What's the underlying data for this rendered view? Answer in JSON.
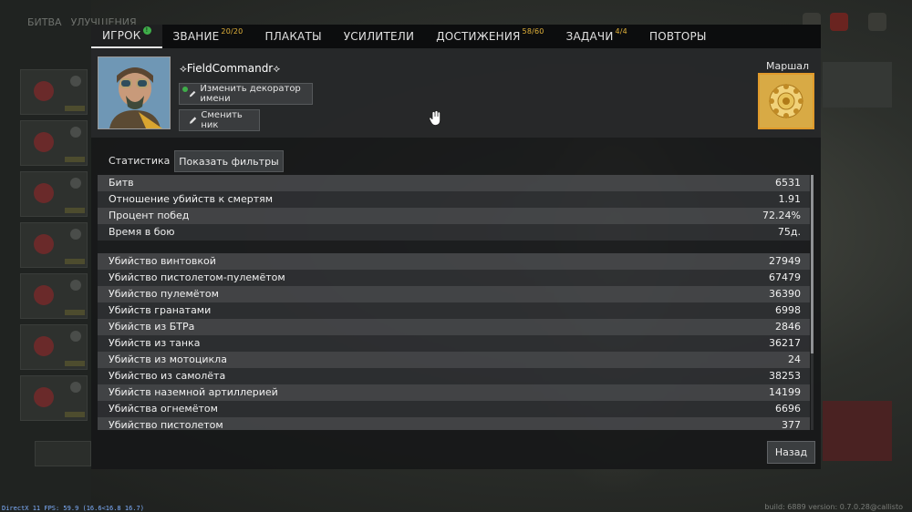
{
  "tabs": [
    {
      "label": "ИГРОК",
      "badge": "!"
    },
    {
      "label": "ЗВАНИЕ",
      "count": "20/20"
    },
    {
      "label": "ПЛАКАТЫ"
    },
    {
      "label": "УСИЛИТЕЛИ"
    },
    {
      "label": "ДОСТИЖЕНИЯ",
      "count": "58/60"
    },
    {
      "label": "ЗАДАЧИ",
      "count": "4/4"
    },
    {
      "label": "ПОВТОРЫ"
    }
  ],
  "background": {
    "tab_battle": "БИТВА",
    "tab_upgrades": "УЛУЧШЕНИЯ"
  },
  "profile": {
    "nickname": "⟡FieldCommandr⟡",
    "change_decorator_label": "Изменить декоратор имени",
    "change_nick_label": "Сменить ник",
    "rank_name": "Маршал"
  },
  "stats": {
    "label": "Статистика",
    "filter_button": "Показать фильтры",
    "general": [
      {
        "name": "Битв",
        "value": "6531"
      },
      {
        "name": "Отношение убийств к смертям",
        "value": "1.91"
      },
      {
        "name": "Процент побед",
        "value": "72.24%"
      },
      {
        "name": "Время в бою",
        "value": "75д."
      }
    ],
    "kills": [
      {
        "name": "Убийство винтовкой",
        "value": "27949"
      },
      {
        "name": "Убийство пистолетом-пулемётом",
        "value": "67479"
      },
      {
        "name": "Убийство пулемётом",
        "value": "36390"
      },
      {
        "name": "Убийств гранатами",
        "value": "6998"
      },
      {
        "name": "Убийств из БТРа",
        "value": "2846"
      },
      {
        "name": "Убийств из танка",
        "value": "36217"
      },
      {
        "name": "Убийств из мотоцикла",
        "value": "24"
      },
      {
        "name": "Убийство из самолёта",
        "value": "38253"
      },
      {
        "name": "Убийств наземной артиллерией",
        "value": "14199"
      },
      {
        "name": "Убийства огнемётом",
        "value": "6696"
      },
      {
        "name": "Убийство пистолетом",
        "value": "377"
      }
    ]
  },
  "back_button": "Назад",
  "footer": {
    "fps": "DirectX 11 FPS: 59.9 (16.6<16.8 16.7)",
    "build": "build: 6889 version: 0.7.0.28@callisto"
  },
  "colors": {
    "accent_count": "#e2b23a",
    "badge_green": "#3fae4a",
    "rank_border": "#e09a2b"
  }
}
